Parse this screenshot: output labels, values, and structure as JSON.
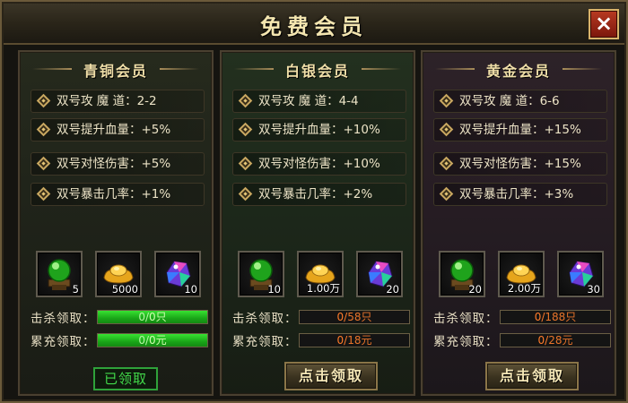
{
  "window": {
    "title": "免费会员",
    "close_icon": "×"
  },
  "labels": {
    "kill": "击杀领取：",
    "recharge": "累充领取："
  },
  "colors": {
    "accent": "#f0dfa8",
    "progress_text": "#ff7b2a",
    "progress_fill": "#1aa618",
    "claimed": "#42d94a"
  },
  "panels": [
    {
      "name": "青铜会员",
      "attrs": [
        "双号攻 魔 道：2-2",
        "双号提升血量：+5%",
        "双号对怪伤害：+5%",
        "双号暴击几率：+1%"
      ],
      "items": [
        {
          "icon": "green-orb-icon",
          "count": "5"
        },
        {
          "icon": "gold-ingot-icon",
          "count": "5000"
        },
        {
          "icon": "rainbow-gem-icon",
          "count": "10"
        }
      ],
      "kill": {
        "current": "0",
        "sep": "/",
        "target": "0只",
        "fill": 1.0
      },
      "recharge": {
        "current": "0",
        "sep": "/",
        "target": "0元",
        "fill": 1.0
      },
      "button": {
        "label": "已领取",
        "state": "claimed"
      }
    },
    {
      "name": "白银会员",
      "attrs": [
        "双号攻 魔 道：4-4",
        "双号提升血量：+10%",
        "双号对怪伤害：+10%",
        "双号暴击几率：+2%"
      ],
      "items": [
        {
          "icon": "green-orb-icon",
          "count": "10"
        },
        {
          "icon": "gold-ingot-icon",
          "count": "1.00万"
        },
        {
          "icon": "rainbow-gem-icon",
          "count": "20"
        }
      ],
      "kill": {
        "current": "0",
        "sep": "/",
        "target": "58只",
        "fill": 0.0
      },
      "recharge": {
        "current": "0",
        "sep": "/",
        "target": "18元",
        "fill": 0.0
      },
      "button": {
        "label": "点击领取",
        "state": "available"
      }
    },
    {
      "name": "黄金会员",
      "attrs": [
        "双号攻 魔 道：6-6",
        "双号提升血量：+15%",
        "双号对怪伤害：+15%",
        "双号暴击几率：+3%"
      ],
      "items": [
        {
          "icon": "green-orb-icon",
          "count": "20"
        },
        {
          "icon": "gold-ingot-icon",
          "count": "2.00万"
        },
        {
          "icon": "rainbow-gem-icon",
          "count": "30"
        }
      ],
      "kill": {
        "current": "0",
        "sep": "/",
        "target": "188只",
        "fill": 0.0
      },
      "recharge": {
        "current": "0",
        "sep": "/",
        "target": "28元",
        "fill": 0.0
      },
      "button": {
        "label": "点击领取",
        "state": "available"
      }
    }
  ]
}
